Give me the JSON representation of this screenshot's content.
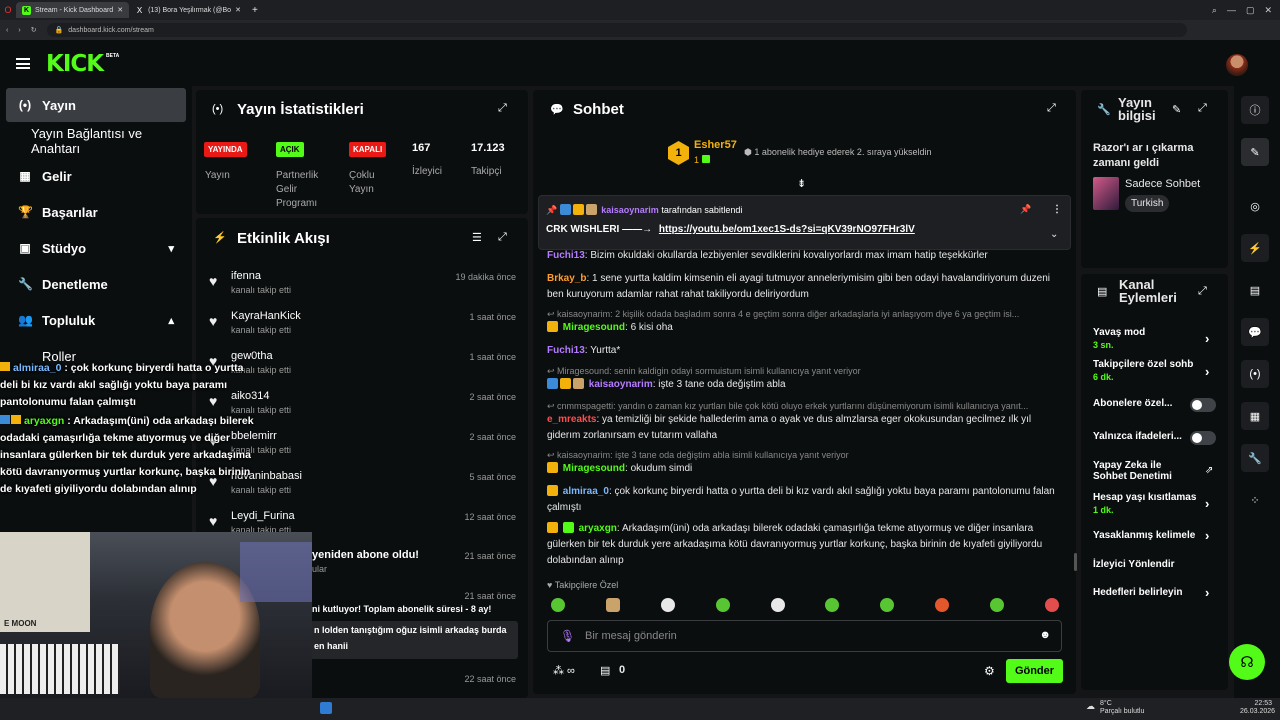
{
  "browser": {
    "tabs": [
      "Stream - Kick Dashboard",
      "(13) Bora Yeşilırmak (@Bo"
    ],
    "url": "dashboard.kick.com/stream"
  },
  "app": {
    "logo": "KICK",
    "beta": "BETA"
  },
  "sidebar": {
    "items": [
      {
        "icon": "(•)",
        "label": "Yayın"
      },
      {
        "icon": "",
        "label": "Yayın Bağlantısı ve Anahtarı"
      },
      {
        "icon": "▦",
        "label": "Gelir"
      },
      {
        "icon": "🏆",
        "label": "Başarılar"
      },
      {
        "icon": "▣",
        "label": "Stüdyo"
      },
      {
        "icon": "🔧",
        "label": "Denetleme"
      },
      {
        "icon": "👥",
        "label": "Topluluk"
      },
      {
        "icon": "",
        "label": "Roller"
      }
    ]
  },
  "stats": {
    "title": "Yayın İstatistikleri",
    "badges": [
      "YAYINDA",
      "AÇIK",
      "KAPALI"
    ],
    "labels": [
      "Yayın",
      "Partnerlik Gelir Programı",
      "Çoklu Yayın"
    ],
    "viewers": {
      "value": "167",
      "label": "İzleyici"
    },
    "followers": {
      "value": "17.123",
      "label": "Takipçi"
    }
  },
  "activity": {
    "title": "Etkinlik Akışı",
    "items": [
      {
        "name": "ifenna",
        "sub": "kanalı takip etti",
        "time": "19 dakika önce"
      },
      {
        "name": "KayraHanKick",
        "sub": "kanalı takip etti",
        "time": "1 saat önce"
      },
      {
        "name": "gew0tha",
        "sub": "kanalı takip etti",
        "time": "1 saat önce"
      },
      {
        "name": "aiko314",
        "sub": "kanalı takip etti",
        "time": "2 saat önce"
      },
      {
        "name": "bbelemirr",
        "sub": "kanalı takip etti",
        "time": "2 saat önce"
      },
      {
        "name": "ridvaninbabasi",
        "sub": "kanalı takip etti",
        "time": "5 saat önce"
      },
      {
        "name": "Leydi_Furina",
        "sub": "kanalı takip etti",
        "time": "12 saat önce"
      },
      {
        "name": "yeniden abone oldu!",
        "sub": "ular",
        "time": "21 saat önce"
      },
      {
        "name": "ni kutluyor! Toplam abonelik süresi - 8 ay!",
        "sub": "",
        "time": "21 saat önce"
      },
      {
        "name": "n lolden tanıştığım oğuz isimli arkadaş burda",
        "sub": "en hanii",
        "time": ""
      },
      {
        "name": "",
        "sub": "",
        "time": "22 saat önce"
      }
    ]
  },
  "chat": {
    "title": "Sohbet",
    "gift": {
      "rank": "1",
      "user": "Esher57",
      "count": "1",
      "text": "1 abonelik hediye ederek 2. sıraya yükseldin"
    },
    "pinned": {
      "by": "kaisaoynarim",
      "by_suffix": "tarafından sabitlendi",
      "text": "CRK WISHLERI ——→",
      "link": "https://youtu.be/om1xec1S-ds?si=qKV39rNO97FHr3lV"
    },
    "messages": [
      {
        "type": "msg",
        "user": "Fuchi13",
        "color": "#b57cff",
        "text": "Bizim okuldaki okullarda lezbiyenler sevdiklerini kovalıyorlardı max imam hatip teşekkürler"
      },
      {
        "type": "msg",
        "user": "Brkay_b",
        "color": "#ff9d2e",
        "text": "1 sene yurtta kaldim kimsenin eli ayagi tutmuyor anneleriymisim gibi ben odayi havalandiriyorum duzeni ben kuruyorum adamlar rahat rahat takiliyordu deliriyordum"
      },
      {
        "type": "reply",
        "text": "kaisaoynarim: 2 kişilik odada başladım sonra 4 e geçtim sonra diğer arkadaşlarla iyi anlaşıyom diye 6 ya geçtim isi..."
      },
      {
        "type": "msg",
        "user": "Miragesound",
        "color": "#53fc18",
        "text": "6 kisi oha"
      },
      {
        "type": "msg",
        "user": "Fuchi13",
        "color": "#b57cff",
        "text": "Yurtta*"
      },
      {
        "type": "reply",
        "text": "Miragesound: senin kaldigin odayi sormuistum isimli kullanıcıya yanıt veriyor"
      },
      {
        "type": "msg",
        "user": "kaisaoynarim",
        "color": "#b57cff",
        "text": "işte 3 tane oda değiştim abla"
      },
      {
        "type": "reply",
        "text": "cnmmspagetti: yandın o zaman kız yurtları bile çok kötü oluyo erkek yurtlarını düşünemiyorum isimli kullanıcıya yanıt..."
      },
      {
        "type": "msg",
        "user": "e_mreakts",
        "color": "#ff4d4d",
        "text": "ya temizliği bir şekide hallederim ama o ayak ve dus almzlarsa eger okokusundan gecilmez ılk yıl giderım zorlanırsam ev tutarım vallaha"
      },
      {
        "type": "reply",
        "text": "kaisaoynarim: işte 3 tane oda değiştim abla isimli kullanıcıya yanıt veriyor"
      },
      {
        "type": "msg",
        "user": "Miragesound",
        "color": "#53fc18",
        "text": "okudum simdi"
      },
      {
        "type": "msg",
        "user": "almiraa_0",
        "color": "#7ab8ff",
        "text": "çok korkunç biryerdi hatta o yurtta deli bi kız vardı akıl sağlığı yoktu baya paramı pantolonumu falan çalmıştı"
      },
      {
        "type": "msg",
        "user": "aryaxgn",
        "color": "#53fc18",
        "text": "Arkadaşım(üni) oda arkadaşı bilerek odadaki çamaşırlığa tekme atıyormuş ve diğer insanlara gülerken bir tek durduk yere arkadaşıma kötü davranıyormuş yurtlar korkunç, başka birinin de kıyafeti giyiliyordu dolabından alınıp"
      }
    ],
    "followers_only": "Takipçilere Özel",
    "input_placeholder": "Bir mesaj gönderin",
    "count": "0",
    "send": "Gönder"
  },
  "stream_info": {
    "title": "Yayın bilgisi",
    "stream_title": "Razor'ı ar   ı çıkarma zamanı geldi",
    "category": "Sadece Sohbet",
    "tag": "Turkish"
  },
  "channel_actions": {
    "title": "Kanal Eylemleri",
    "items": [
      {
        "label": "Yavaş mod",
        "sub": "3 sn.",
        "ctrl": "chev"
      },
      {
        "label": "Takipçilere özel sohb",
        "sub": "6 dk.",
        "ctrl": "chev"
      },
      {
        "label": "Abonelere özel...",
        "sub": "",
        "ctrl": "toggle"
      },
      {
        "label": "Yalnızca ifadeleri...",
        "sub": "",
        "ctrl": "toggle"
      },
      {
        "label": "Yapay Zeka ile Sohbet Denetimi",
        "sub": "",
        "ctrl": "ext"
      },
      {
        "label": "Hesap yaşı kısıtlamas",
        "sub": "1 dk.",
        "ctrl": "chev"
      },
      {
        "label": "Yasaklanmış kelimele",
        "sub": "",
        "ctrl": "chev"
      },
      {
        "label": "İzleyici Yönlendir",
        "sub": "",
        "ctrl": "none"
      },
      {
        "label": "Hedefleri belirleyin",
        "sub": "",
        "ctrl": "chev"
      }
    ]
  },
  "overlay": {
    "lines": [
      {
        "user": "almiraa_0",
        "text": " : çok korkunç biryerdi hatta o yurtta deli bi kız vardı akıl sağlığı yoktu baya paramı pantolonumu falan çalmıştı"
      },
      {
        "user": "aryaxgn",
        "text": " : Arkadaşım(üni) oda arkadaşı bilerek odadaki çamaşırlığa tekme atıyormuş ve diğer insanlara gülerken bir tek durduk yere arkadaşıma kötü davranıyormuş yurtlar korkunç, başka birinin de kıyafeti giyiliyordu dolabından alınıp"
      }
    ],
    "poster": "E MOON"
  },
  "taskbar": {
    "weather": "8°C",
    "weather_sub": "Parçalı bulutlu",
    "time": "22:53",
    "date": "26.03.2026"
  },
  "colors": {
    "brand": "#53fc18",
    "live": "#e91916",
    "panel": "#0b0e0f"
  }
}
